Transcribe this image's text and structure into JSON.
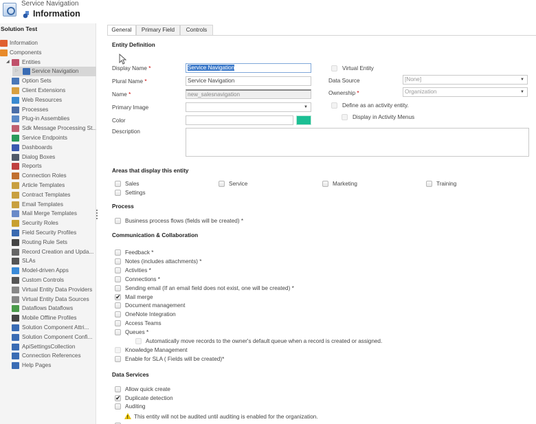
{
  "header": {
    "subtitle": "Service Navigation",
    "title": "Information"
  },
  "sidebar": {
    "solution": "Solution Test",
    "items": [
      {
        "label": "Information",
        "level": 0,
        "icon": "information-icon",
        "color": "#e06030"
      },
      {
        "label": "Components",
        "level": 0,
        "icon": "components-icon",
        "color": "#e88a2a"
      },
      {
        "label": "Entities",
        "level": 1,
        "icon": "entities-icon",
        "color": "#c0506a",
        "expanded": true
      },
      {
        "label": "Service Navigation",
        "level": 2,
        "icon": "entity-icon",
        "color": "#3a6cb4",
        "selected": true
      },
      {
        "label": "Option Sets",
        "level": 1,
        "icon": "option-sets-icon",
        "color": "#4a78b8"
      },
      {
        "label": "Client Extensions",
        "level": 1,
        "icon": "client-extensions-icon",
        "color": "#d8a040"
      },
      {
        "label": "Web Resources",
        "level": 1,
        "icon": "web-resources-icon",
        "color": "#3a8ad0"
      },
      {
        "label": "Processes",
        "level": 1,
        "icon": "processes-icon",
        "color": "#4a6ea8"
      },
      {
        "label": "Plug-in Assemblies",
        "level": 1,
        "icon": "plugin-assemblies-icon",
        "color": "#5a8ac8"
      },
      {
        "label": "Sdk Message Processing St...",
        "level": 1,
        "icon": "sdk-message-icon",
        "color": "#c06070"
      },
      {
        "label": "Service Endpoints",
        "level": 1,
        "icon": "service-endpoints-icon",
        "color": "#2a9a5a"
      },
      {
        "label": "Dashboards",
        "level": 1,
        "icon": "dashboards-icon",
        "color": "#3a5ab0"
      },
      {
        "label": "Dialog Boxes",
        "level": 1,
        "icon": "dialog-boxes-icon",
        "color": "#505a6a"
      },
      {
        "label": "Reports",
        "level": 1,
        "icon": "reports-icon",
        "color": "#c04040"
      },
      {
        "label": "Connection Roles",
        "level": 1,
        "icon": "connection-roles-icon",
        "color": "#c07030"
      },
      {
        "label": "Article Templates",
        "level": 1,
        "icon": "article-templates-icon",
        "color": "#c8a040"
      },
      {
        "label": "Contract Templates",
        "level": 1,
        "icon": "contract-templates-icon",
        "color": "#c8a040"
      },
      {
        "label": "Email Templates",
        "level": 1,
        "icon": "email-templates-icon",
        "color": "#c8a040"
      },
      {
        "label": "Mail Merge Templates",
        "level": 1,
        "icon": "mail-merge-templates-icon",
        "color": "#6a8ac8"
      },
      {
        "label": "Security Roles",
        "level": 1,
        "icon": "security-roles-icon",
        "color": "#c8a030"
      },
      {
        "label": "Field Security Profiles",
        "level": 1,
        "icon": "field-security-profiles-icon",
        "color": "#3a6ab0"
      },
      {
        "label": "Routing Rule Sets",
        "level": 1,
        "icon": "routing-rule-sets-icon",
        "color": "#444444"
      },
      {
        "label": "Record Creation and Upda...",
        "level": 1,
        "icon": "record-creation-icon",
        "color": "#666666"
      },
      {
        "label": "SLAs",
        "level": 1,
        "icon": "slas-icon",
        "color": "#555555"
      },
      {
        "label": "Model-driven Apps",
        "level": 1,
        "icon": "model-driven-apps-icon",
        "color": "#3a8ad8"
      },
      {
        "label": "Custom Controls",
        "level": 1,
        "icon": "custom-controls-icon",
        "color": "#555555"
      },
      {
        "label": "Virtual Entity Data Providers",
        "level": 1,
        "icon": "virtual-entity-providers-icon",
        "color": "#888888"
      },
      {
        "label": "Virtual Entity Data Sources",
        "level": 1,
        "icon": "virtual-entity-sources-icon",
        "color": "#888888"
      },
      {
        "label": "Dataflows Dataflows",
        "level": 1,
        "icon": "dataflows-icon",
        "color": "#4a9a4a"
      },
      {
        "label": "Mobile Offline Profiles",
        "level": 1,
        "icon": "mobile-offline-profiles-icon",
        "color": "#444444"
      },
      {
        "label": "Solution Component Attri...",
        "level": 1,
        "icon": "entity-icon",
        "color": "#3a6cb4"
      },
      {
        "label": "Solution Component Confi...",
        "level": 1,
        "icon": "entity-icon",
        "color": "#3a6cb4"
      },
      {
        "label": "ApiSettingsCollection",
        "level": 1,
        "icon": "entity-icon",
        "color": "#3a6cb4"
      },
      {
        "label": "Connection References",
        "level": 1,
        "icon": "entity-icon",
        "color": "#3a6cb4"
      },
      {
        "label": "Help Pages",
        "level": 1,
        "icon": "entity-icon",
        "color": "#3a6cb4"
      }
    ]
  },
  "tabs": [
    {
      "label": "General",
      "active": true
    },
    {
      "label": "Primary Field",
      "active": false
    },
    {
      "label": "Controls",
      "active": false
    }
  ],
  "entity_definition": {
    "title": "Entity Definition",
    "display_name_label": "Display Name",
    "display_name_value": "Service Navigation",
    "plural_name_label": "Plural Name",
    "plural_name_value": "Service Navigation",
    "name_label": "Name",
    "name_value": "new_salesnavigation",
    "primary_image_label": "Primary Image",
    "primary_image_value": "",
    "color_label": "Color",
    "color_value": "",
    "color_swatch": "#1cbf94",
    "description_label": "Description",
    "description_value": "",
    "required_mark": "*",
    "virtual_entity_label": "Virtual Entity",
    "virtual_entity_checked": false,
    "data_source_label": "Data Source",
    "data_source_value": "[None]",
    "ownership_label": "Ownership",
    "ownership_value": "Organization",
    "activity_entity_label": "Define as an activity entity.",
    "activity_menus_label": "Display in Activity Menus"
  },
  "areas": {
    "title": "Areas that display this entity",
    "items": [
      {
        "label": "Sales",
        "checked": false
      },
      {
        "label": "Service",
        "checked": false
      },
      {
        "label": "Marketing",
        "checked": false
      },
      {
        "label": "Training",
        "checked": false
      },
      {
        "label": "Settings",
        "checked": false
      }
    ]
  },
  "process": {
    "title": "Process",
    "items": [
      {
        "label": "Business process flows (fields will be created) *",
        "checked": false
      }
    ]
  },
  "communication": {
    "title": "Communication & Collaboration",
    "items": [
      {
        "label": "Feedback *",
        "checked": false
      },
      {
        "label": "Notes (includes attachments) *",
        "checked": false
      },
      {
        "label": "Activities *",
        "checked": false
      },
      {
        "label": "Connections *",
        "checked": false
      },
      {
        "label": "Sending email (If an email field does not exist, one will be created) *",
        "checked": false
      },
      {
        "label": "Mail merge",
        "checked": true
      },
      {
        "label": "Document management",
        "checked": false
      },
      {
        "label": "OneNote Integration",
        "checked": false
      },
      {
        "label": "Access Teams",
        "checked": false
      },
      {
        "label": "Queues *",
        "checked": false
      },
      {
        "label": "Automatically move records to the owner's default queue when a record is created or assigned.",
        "checked": false,
        "indent": true,
        "disabled": true
      },
      {
        "label": "Knowledge Management",
        "checked": false,
        "disabled": true
      },
      {
        "label": "Enable for SLA ( Fields will be created)*",
        "checked": false
      }
    ]
  },
  "data_services": {
    "title": "Data Services",
    "items": [
      {
        "label": "Allow quick create",
        "checked": false
      },
      {
        "label": "Duplicate detection",
        "checked": true
      },
      {
        "label": "Auditing",
        "checked": false
      }
    ],
    "warning": "This entity will not be audited until auditing is enabled for the organization."
  }
}
